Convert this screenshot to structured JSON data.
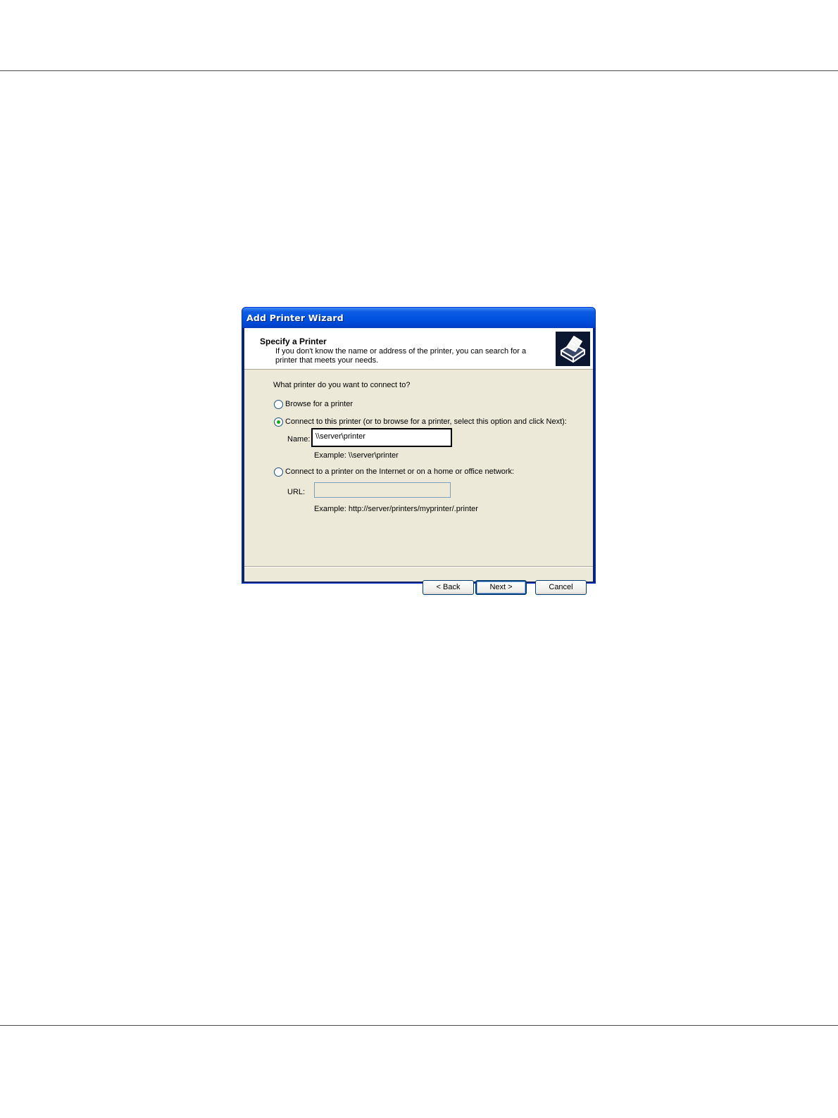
{
  "window": {
    "title": "Add Printer Wizard"
  },
  "header": {
    "title": "Specify a Printer",
    "subtitle": "If you don't know the name or address of the printer, you can search for a printer that meets your needs.",
    "icon": "printer-icon"
  },
  "body": {
    "question": "What printer do you want to connect to?",
    "options": [
      {
        "label": "Browse for a printer",
        "selected": false
      },
      {
        "label": "Connect to this printer (or to browse for a printer, select this option and click Next):",
        "selected": true
      },
      {
        "label": "Connect to a printer on the Internet or on a home or office network:",
        "selected": false
      }
    ],
    "name_field": {
      "label": "Name:",
      "value": "\\\\server\\printer",
      "example": "Example: \\\\server\\printer"
    },
    "url_field": {
      "label": "URL:",
      "value": "",
      "example": "Example: http://server/printers/myprinter/.printer"
    }
  },
  "buttons": {
    "back": "< Back",
    "next": "Next >",
    "cancel": "Cancel"
  }
}
